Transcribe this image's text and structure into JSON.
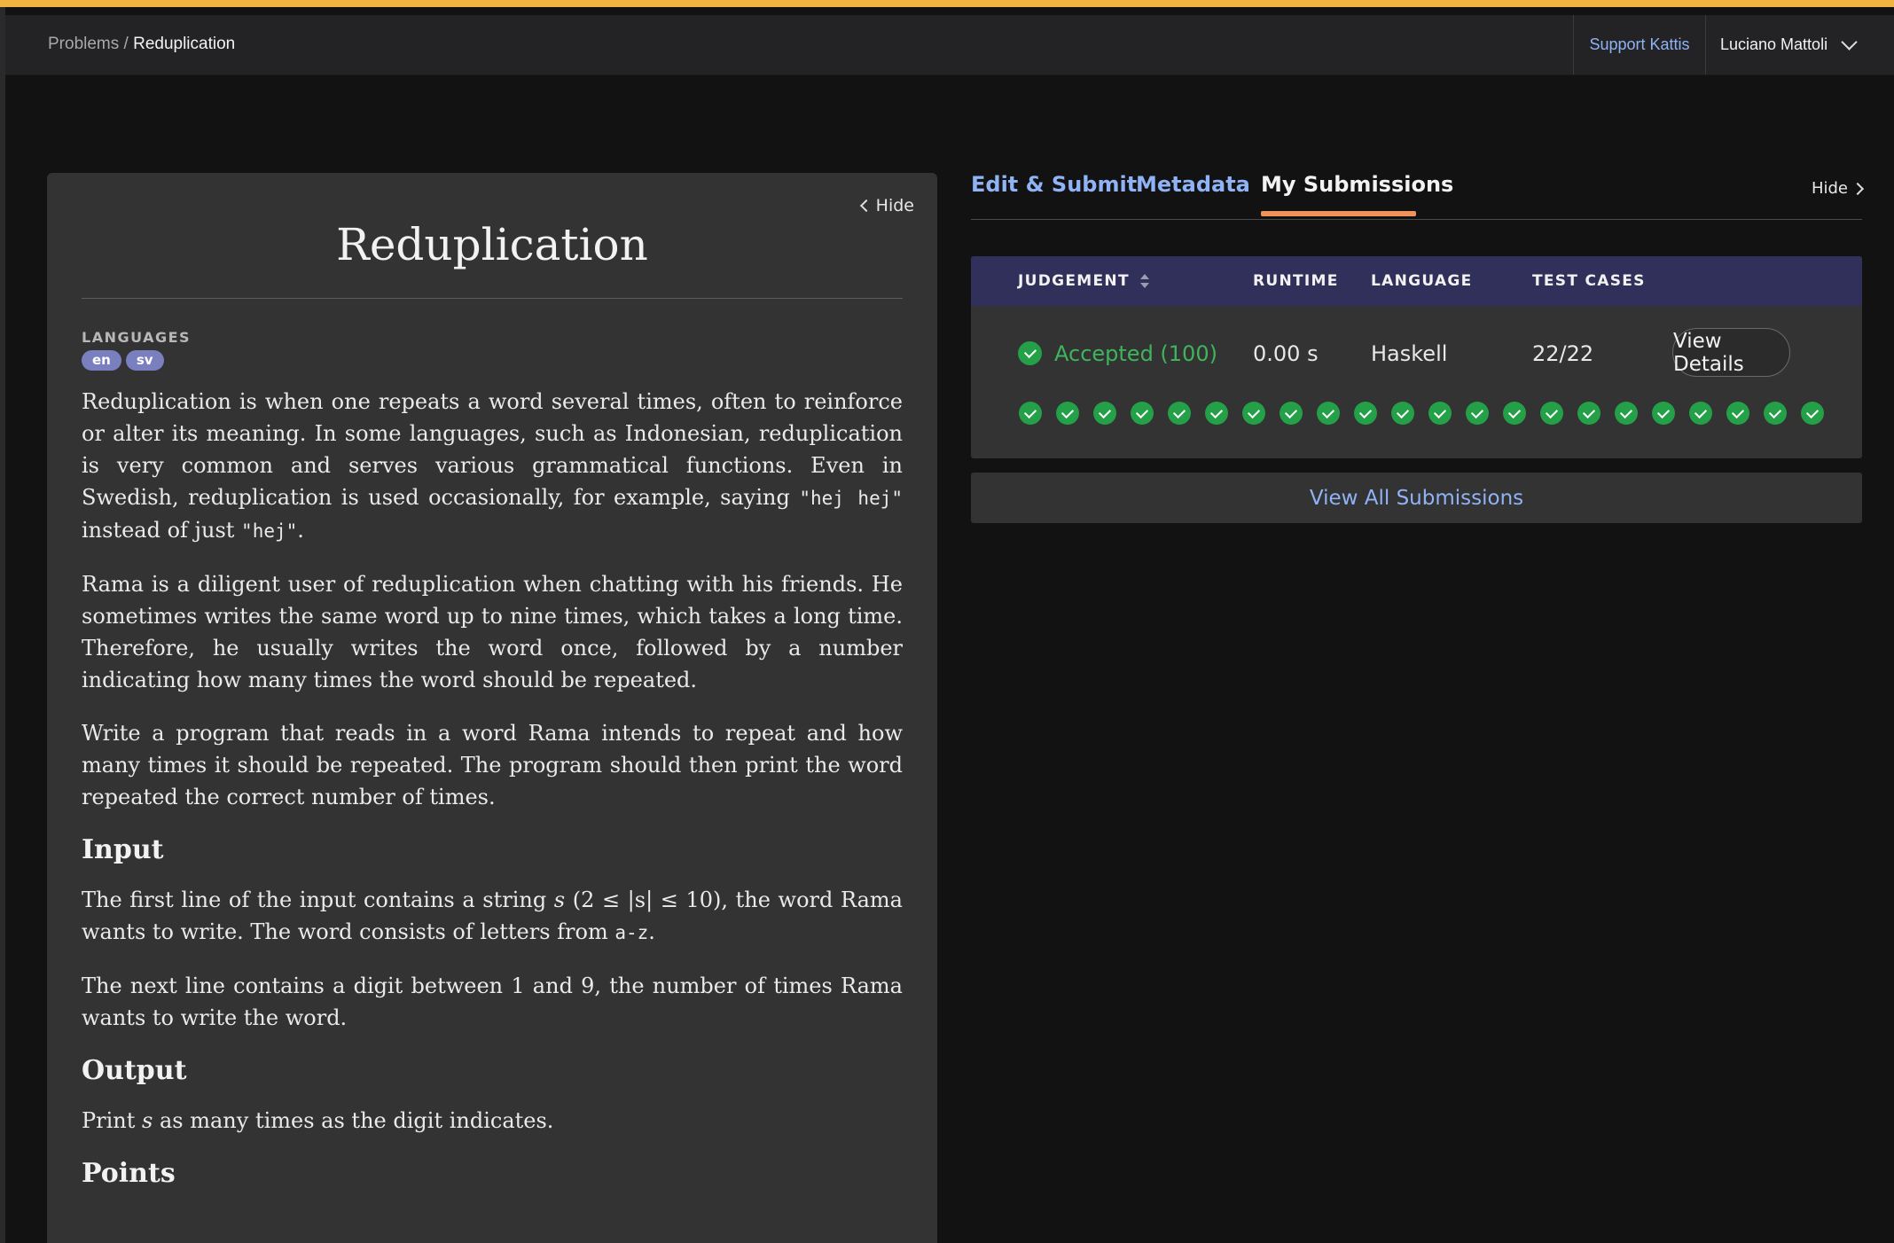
{
  "topnav": {
    "breadcrumb_root": "Problems",
    "breadcrumb_sep": "/",
    "breadcrumb_current": "Reduplication",
    "support_label": "Support Kattis",
    "user_name": "Luciano Mattoli"
  },
  "problem": {
    "hide_label": "Hide",
    "title": "Reduplication",
    "languages_label": "LANGUAGES",
    "languages": [
      "en",
      "sv"
    ],
    "p1_a": "Reduplication is when one repeats a word several times, often to reinforce or alter its meaning. In some languages, such as Indonesian, reduplication is very common and serves various grammatical functions. Even in Swedish, reduplication is used occasionally, for example, saying ",
    "p1_code1": "\"hej hej\"",
    "p1_b": " instead of just ",
    "p1_code2": "\"hej\"",
    "p1_c": ".",
    "p2": "Rama is a diligent user of reduplication when chatting with his friends. He sometimes writes the same word up to nine times, which takes a long time. Therefore, he usually writes the word once, followed by a number indicating how many times the word should be repeated.",
    "p3": "Write a program that reads in a word Rama intends to repeat and how many times it should be repeated. The program should then print the word repeated the correct number of times.",
    "input_heading": "Input",
    "input_p1_a": "The first line of the input contains a string ",
    "input_p1_math1": "s",
    "input_p1_math2": "(2 ≤ |s| ≤ 10)",
    "input_p1_b": ", the word Rama wants to write. The word consists of letters from ",
    "input_p1_code": "a-z",
    "input_p1_c": ".",
    "input_p2": "The next line contains a digit between 1 and 9, the number of times Rama wants to write the word.",
    "output_heading": "Output",
    "output_p_a": "Print ",
    "output_p_math": "s",
    "output_p_b": " as many times as the digit indicates.",
    "points_heading": "Points"
  },
  "tabs": {
    "edit_submit": "Edit & Submit",
    "metadata": "Metadata",
    "my_submissions": "My Submissions",
    "active": "my_submissions",
    "hide_label": "Hide"
  },
  "submissions": {
    "headers": {
      "judgement": "JUDGEMENT",
      "runtime": "RUNTIME",
      "language": "LANGUAGE",
      "test_cases": "TEST CASES"
    },
    "row": {
      "judgement": "Accepted (100)",
      "runtime": "0.00 s",
      "language": "Haskell",
      "test_cases": "22/22",
      "view_details": "View Details",
      "passed_cases": 22
    },
    "view_all": "View All Submissions"
  },
  "colors": {
    "accent_bar": "#f0b541",
    "link": "#8fb3f5",
    "accepted": "#3eb55c",
    "tab_underline": "#f0935b",
    "table_header": "#31305a"
  }
}
